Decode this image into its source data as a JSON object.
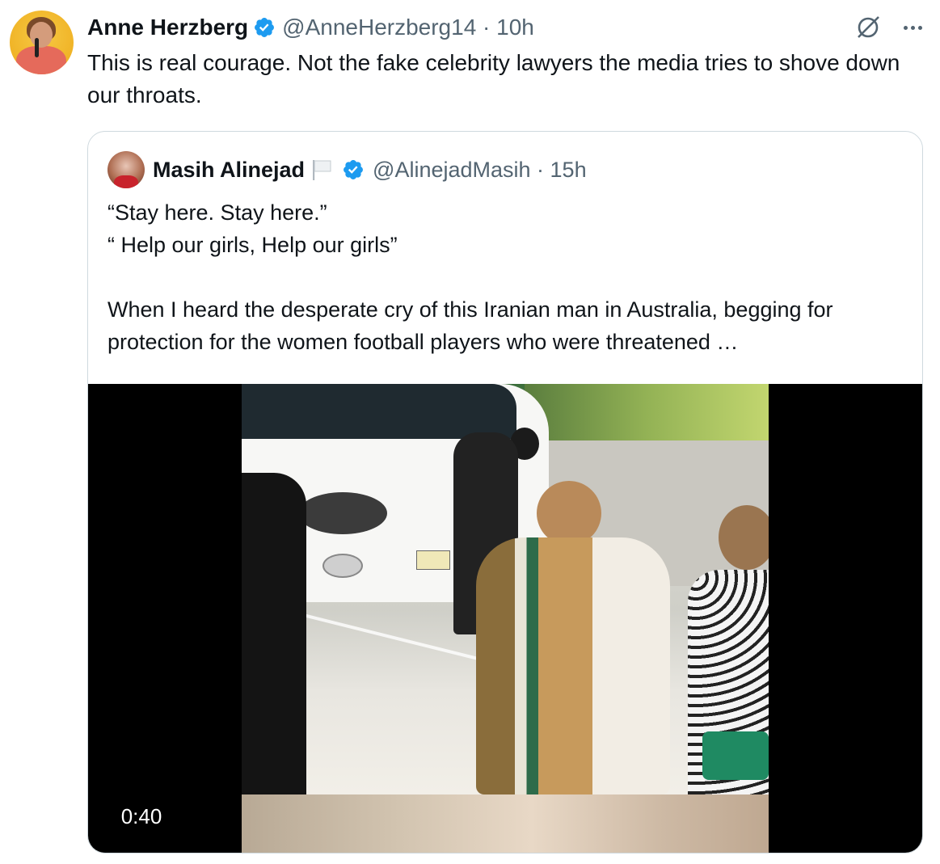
{
  "tweet": {
    "author_name": "Anne Herzberg",
    "author_handle": "@AnneHerzberg14 · 10h",
    "text": "This is real courage. Not the fake celebrity lawyers the media tries to shove down our throats.",
    "accent_color": "#1d9bf0"
  },
  "quote": {
    "author_name": "Masih Alinejad",
    "author_handle": "@AlinejadMasih · 15h",
    "text": "“Stay here. Stay here.”\n“ Help our girls, Help our girls”\n\nWhen I heard the desperate cry of this Iranian man in Australia, begging for protection for the women football players who were threatened …",
    "video_duration": "0:40"
  },
  "icons": {
    "verified": "verified-badge-icon",
    "grok": "grok-icon",
    "more": "more-options-icon",
    "flag": "white-flag-icon"
  }
}
